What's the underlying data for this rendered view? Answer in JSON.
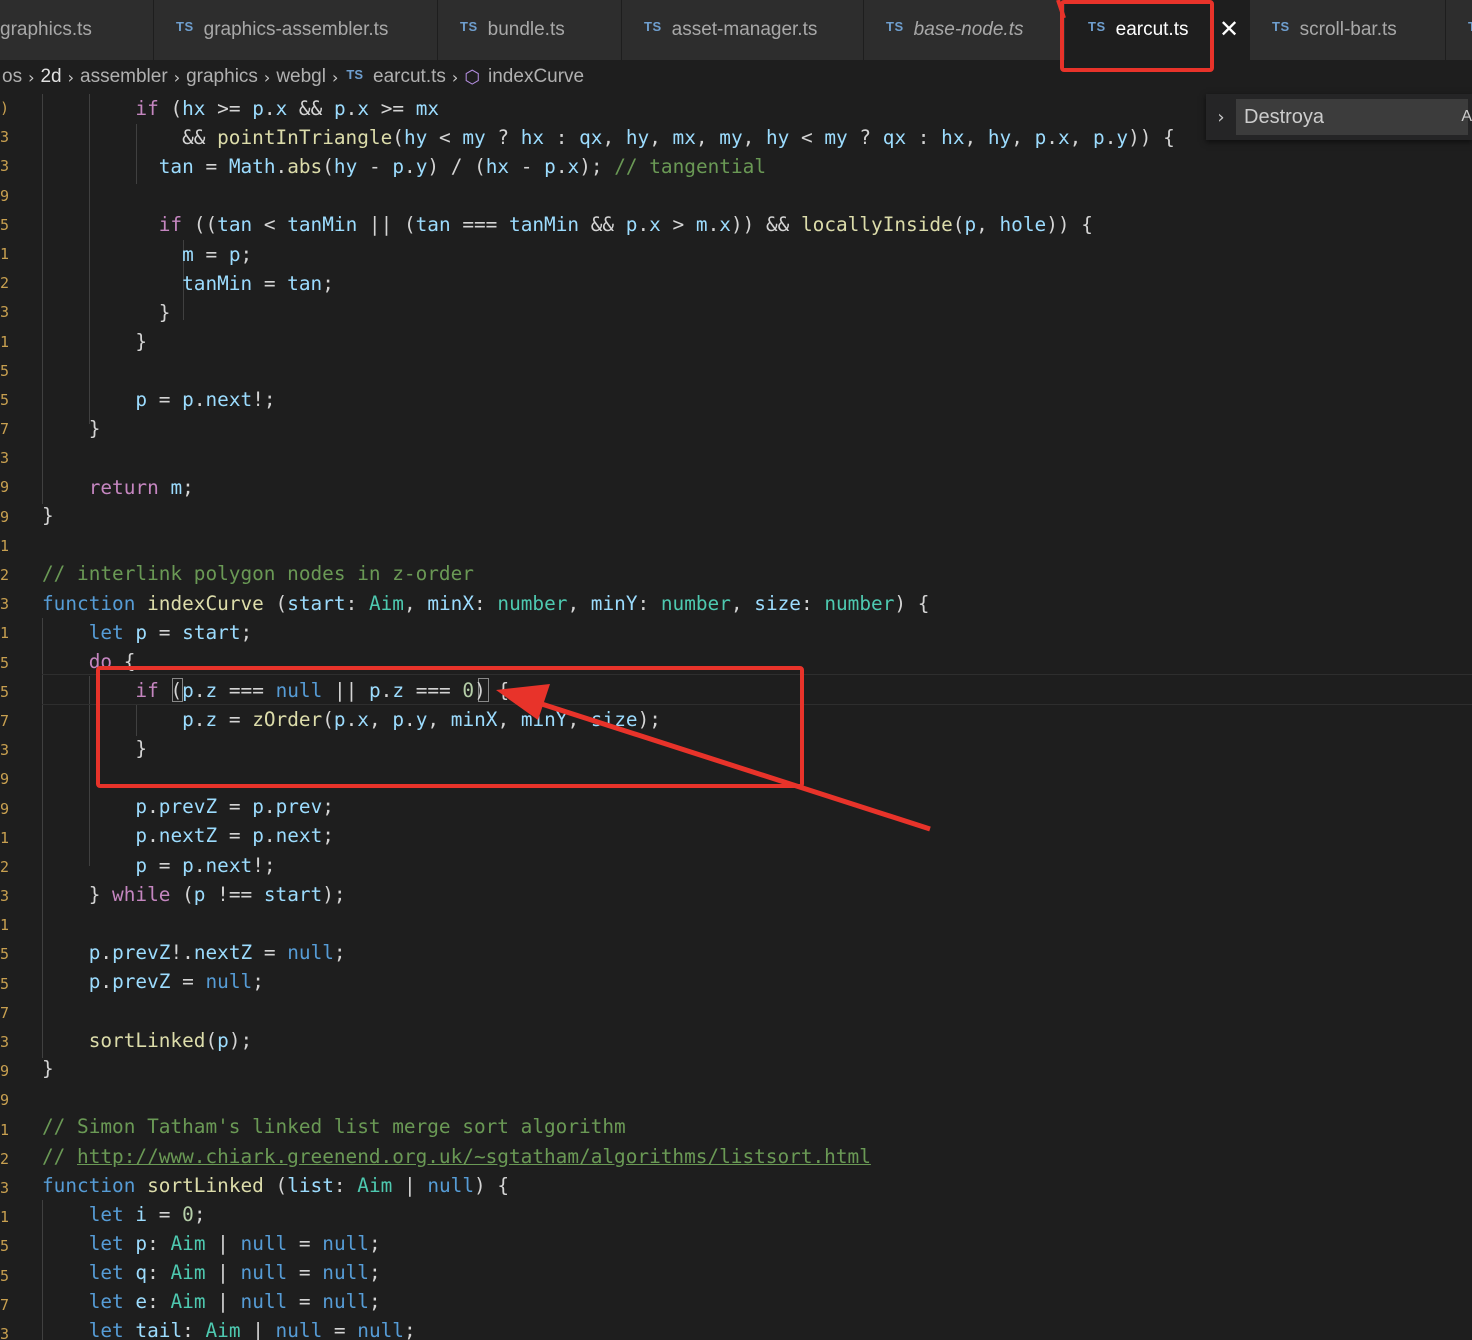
{
  "tabs": [
    {
      "ts": "",
      "label": "graphics.ts",
      "active": false
    },
    {
      "ts": "TS",
      "label": "graphics-assembler.ts",
      "active": false
    },
    {
      "ts": "TS",
      "label": "bundle.ts",
      "active": false
    },
    {
      "ts": "TS",
      "label": "asset-manager.ts",
      "active": false
    },
    {
      "ts": "TS",
      "label": "base-node.ts",
      "active": false
    },
    {
      "ts": "TS",
      "label": "earcut.ts",
      "active": true
    },
    {
      "ts": "TS",
      "label": "scroll-bar.ts",
      "active": false
    },
    {
      "ts": "T",
      "label": "",
      "active": false
    }
  ],
  "tab_close_glyph": "✕",
  "breadcrumb": {
    "items": [
      "os",
      "2d",
      "assembler",
      "graphics",
      "webgl"
    ],
    "file_badge": "TS",
    "file": "earcut.ts",
    "symbol_icon": "cube-icon",
    "symbol": "indexCurve",
    "separator": "›"
  },
  "find_widget": {
    "toggle": "›",
    "value": "Destroya",
    "option": "A"
  },
  "gutter_marks": [
    ")",
    "3",
    "3",
    "9",
    "5",
    "1",
    "2",
    "3",
    "1",
    "5",
    "5",
    "7",
    "3",
    "9",
    "9",
    "1",
    "2",
    "3",
    "1",
    "5",
    "5",
    "7",
    "3",
    "9",
    "9",
    "1",
    "2",
    "3",
    "1",
    "5",
    "5",
    "7",
    "3",
    "9",
    "9",
    "1",
    "2",
    "3",
    "1",
    "5",
    "5",
    "7",
    "3"
  ],
  "code": {
    "l1": {
      "indent": "        ",
      "kw": "if",
      "rest1": " (",
      "v1": "hx",
      "rest2": " >= ",
      "v2": "p",
      "rest3": ".",
      "v3": "x",
      "rest4": " && ",
      "v4": "p",
      "rest5": ".",
      "v5": "x",
      "rest6": " >= ",
      "v6": "mx"
    },
    "l2": {
      "indent": "            ",
      "text1": "&& ",
      "fn": "pointInTriangle",
      "text2": "(",
      "v1": "hy",
      "text3": " < ",
      "v2": "my",
      "text4": " ? ",
      "v3": "hx",
      "text5": " : ",
      "v4": "qx",
      "text6": ", ",
      "v5": "hy",
      "text7": ", ",
      "v6": "mx",
      "text8": ", ",
      "v7": "my",
      "text9": ", ",
      "v8": "hy",
      "text10": " < ",
      "v9": "my",
      "text11": " ? ",
      "v10": "qx",
      "text12": " : ",
      "v11": "hx",
      "text13": ", ",
      "v12": "hy",
      "text14": ", ",
      "v13": "p",
      "text15": ".",
      "v14": "x",
      "text16": ", ",
      "v15": "p",
      "text17": ".",
      "v16": "y",
      "text18": ")) {"
    },
    "l3": {
      "indent": "          ",
      "v1": "tan",
      "t1": " = ",
      "v2": "Math",
      "t2": ".",
      "fn": "abs",
      "t3": "(",
      "v3": "hy",
      "t4": " - ",
      "v4": "p",
      "t5": ".",
      "v5": "y",
      "t6": ") / (",
      "v6": "hx",
      "t7": " - ",
      "v7": "p",
      "t8": ".",
      "v8": "x",
      "t9": "); ",
      "com": "// tangential"
    },
    "l5": {
      "indent": "          ",
      "kw": "if",
      "t1": " ((",
      "v1": "tan",
      "t2": " < ",
      "v2": "tanMin",
      "t3": " || (",
      "v3": "tan",
      "t4": " === ",
      "v4": "tanMin",
      "t5": " && ",
      "v5": "p",
      "t6": ".",
      "v6": "x",
      "t7": " > ",
      "v7": "m",
      "t8": ".",
      "v8": "x",
      "t9": ")) && ",
      "fn": "locallyInside",
      "t10": "(",
      "v9": "p",
      "t11": ", ",
      "v10": "hole",
      "t12": ")) {"
    },
    "l6": {
      "indent": "            ",
      "v1": "m",
      "t1": " = ",
      "v2": "p",
      "t2": ";"
    },
    "l7": {
      "indent": "            ",
      "v1": "tanMin",
      "t1": " = ",
      "v2": "tan",
      "t2": ";"
    },
    "l8": {
      "text": "          }"
    },
    "l9": {
      "text": "        }"
    },
    "l11": {
      "indent": "        ",
      "v1": "p",
      "t1": " = ",
      "v2": "p",
      "t2": ".",
      "v3": "next",
      "t3": "!;"
    },
    "l12": {
      "text": "    }"
    },
    "l14": {
      "indent": "    ",
      "kw": "return",
      "t1": " ",
      "v1": "m",
      "t2": ";"
    },
    "l15": {
      "text": "}"
    },
    "l17": {
      "com": "// interlink polygon nodes in z-order"
    },
    "l18": {
      "kw": "function",
      "t1": " ",
      "fn": "indexCurve",
      "t2": " (",
      "v1": "start",
      "t3": ": ",
      "ty1": "Aim",
      "t4": ", ",
      "v2": "minX",
      "t5": ": ",
      "ty2": "number",
      "t6": ", ",
      "v3": "minY",
      "t7": ": ",
      "ty3": "number",
      "t8": ", ",
      "v4": "size",
      "t9": ": ",
      "ty4": "number",
      "t10": ") {"
    },
    "l19": {
      "indent": "    ",
      "kw": "let",
      "t1": " ",
      "v1": "p",
      "t2": " = ",
      "v2": "start",
      "t3": ";"
    },
    "l20": {
      "indent": "    ",
      "kw": "do",
      "t1": " {"
    },
    "l21": {
      "indent": "        ",
      "kw": "if",
      "t1": " (",
      "v1": "p",
      "t2": ".",
      "v2": "z",
      "t3": " === ",
      "kw2": "null",
      "t4": " || ",
      "v3": "p",
      "t5": ".",
      "v4": "z",
      "t6": " === ",
      "num": "0",
      "t7": ") {"
    },
    "l22": {
      "indent": "            ",
      "v1": "p",
      "t1": ".",
      "v2": "z",
      "t2": " = ",
      "fn": "zOrder",
      "t3": "(",
      "v3": "p",
      "t4": ".",
      "v4": "x",
      "t5": ", ",
      "v5": "p",
      "t6": ".",
      "v6": "y",
      "t7": ", ",
      "v7": "minX",
      "t8": ", ",
      "v8": "minY",
      "t9": ", ",
      "v9": "size",
      "t10": ");"
    },
    "l23": {
      "text": "        }"
    },
    "l25": {
      "indent": "        ",
      "v1": "p",
      "t1": ".",
      "v2": "prevZ",
      "t2": " = ",
      "v3": "p",
      "t3": ".",
      "v4": "prev",
      "t4": ";"
    },
    "l26": {
      "indent": "        ",
      "v1": "p",
      "t1": ".",
      "v2": "nextZ",
      "t2": " = ",
      "v3": "p",
      "t3": ".",
      "v4": "next",
      "t4": ";"
    },
    "l27": {
      "indent": "        ",
      "v1": "p",
      "t1": " = ",
      "v2": "p",
      "t2": ".",
      "v3": "next",
      "t3": "!;"
    },
    "l28": {
      "t0": "    } ",
      "kw": "while",
      "t1": " (",
      "v1": "p",
      "t2": " !== ",
      "v2": "start",
      "t3": ");"
    },
    "l30": {
      "indent": "    ",
      "v1": "p",
      "t1": ".",
      "v2": "prevZ",
      "t2": "!.",
      "v3": "nextZ",
      "t3": " = ",
      "kw": "null",
      "t4": ";"
    },
    "l31": {
      "indent": "    ",
      "v1": "p",
      "t1": ".",
      "v2": "prevZ",
      "t2": " = ",
      "kw": "null",
      "t3": ";"
    },
    "l33": {
      "indent": "    ",
      "fn": "sortLinked",
      "t1": "(",
      "v1": "p",
      "t2": ");"
    },
    "l34": {
      "text": "}"
    },
    "l36": {
      "com": "// Simon Tatham's linked list merge sort algorithm"
    },
    "l37": {
      "com": "// ",
      "link": "http://www.chiark.greenend.org.uk/~sgtatham/algorithms/listsort.html"
    },
    "l38": {
      "kw": "function",
      "t1": " ",
      "fn": "sortLinked",
      "t2": " (",
      "v1": "list",
      "t3": ": ",
      "ty1": "Aim",
      "t4": " | ",
      "kw2": "null",
      "t5": ") {"
    },
    "l39": {
      "indent": "    ",
      "kw": "let",
      "t1": " ",
      "v1": "i",
      "t2": " = ",
      "num": "0",
      "t3": ";"
    },
    "l40": {
      "indent": "    ",
      "kw": "let",
      "t1": " ",
      "v1": "p",
      "t2": ": ",
      "ty": "Aim",
      "t3": " | ",
      "kw2": "null",
      "t4": " = ",
      "kw3": "null",
      "t5": ";"
    },
    "l41": {
      "indent": "    ",
      "kw": "let",
      "t1": " ",
      "v1": "q",
      "t2": ": ",
      "ty": "Aim",
      "t3": " | ",
      "kw2": "null",
      "t4": " = ",
      "kw3": "null",
      "t5": ";"
    },
    "l42": {
      "indent": "    ",
      "kw": "let",
      "t1": " ",
      "v1": "e",
      "t2": ": ",
      "ty": "Aim",
      "t3": " | ",
      "kw2": "null",
      "t4": " = ",
      "kw3": "null",
      "t5": ";"
    },
    "l43": {
      "indent": "    ",
      "kw": "let",
      "t1": " ",
      "v1": "tail",
      "t2": ": ",
      "ty": "Aim",
      "t3": " | ",
      "kw2": "null",
      "t4": " = ",
      "kw3": "null",
      "t5": ";"
    }
  },
  "annotation_color": "#e8332a"
}
